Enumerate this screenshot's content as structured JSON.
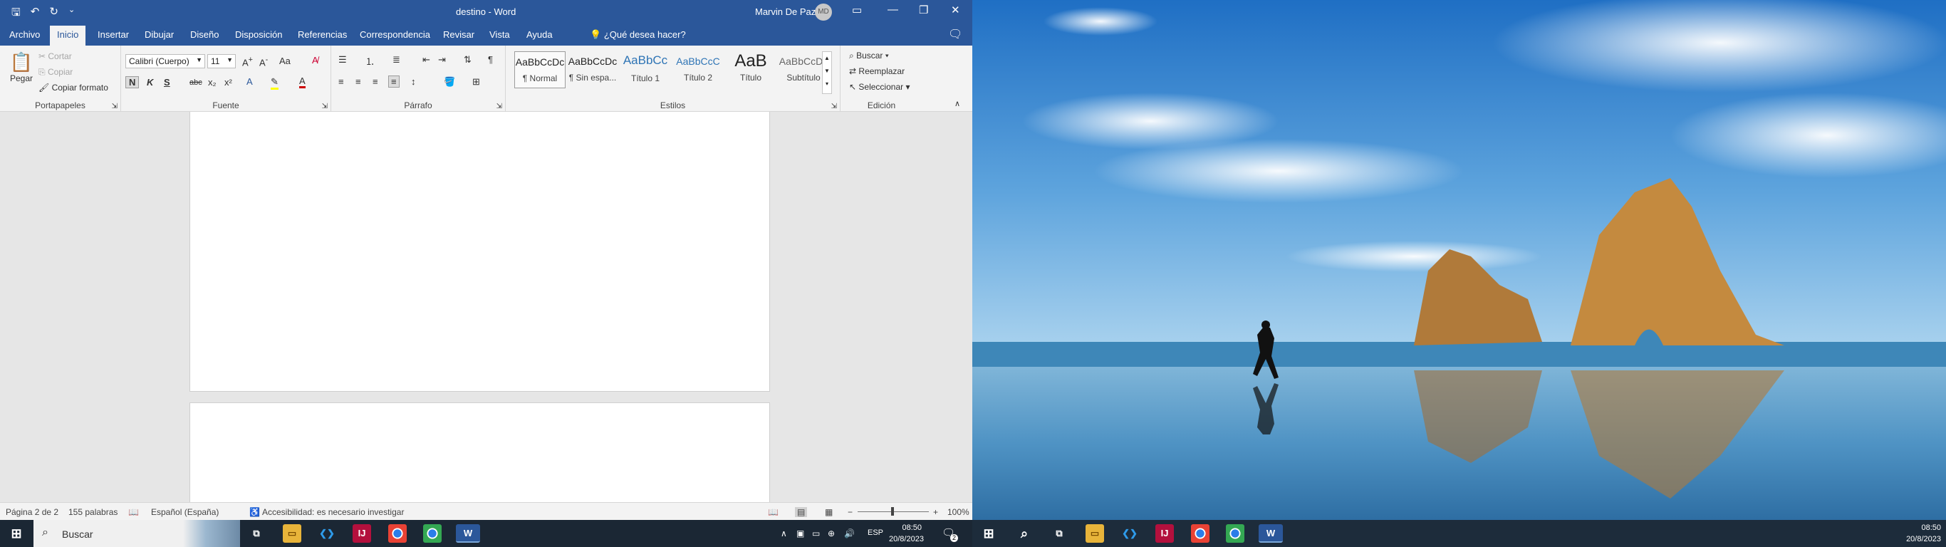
{
  "word": {
    "title": "destino  -  Word",
    "user_name": "Marvin De Paz",
    "user_initials": "MD",
    "tabs": [
      "Archivo",
      "Inicio",
      "Insertar",
      "Dibujar",
      "Diseño",
      "Disposición",
      "Referencias",
      "Correspondencia",
      "Revisar",
      "Vista",
      "Ayuda"
    ],
    "active_tab": "Inicio",
    "tell_me": "¿Qué desea hacer?",
    "clipboard": {
      "paste": "Pegar",
      "cut": "Cortar",
      "copy": "Copiar",
      "format_painter": "Copiar formato",
      "label": "Portapapeles"
    },
    "font": {
      "name": "Calibri (Cuerpo)",
      "size": "11",
      "label": "Fuente",
      "change_case": "Aa",
      "bold": "N",
      "italic": "K",
      "underline": "S",
      "strike": "abc",
      "sub": "x₂",
      "super": "x²"
    },
    "paragraph": {
      "label": "Párrafo"
    },
    "styles": {
      "label": "Estilos",
      "items": [
        {
          "sample": "AaBbCcDc",
          "name": "¶ Normal"
        },
        {
          "sample": "AaBbCcDc",
          "name": "¶ Sin espa..."
        },
        {
          "sample": "AaBbCc",
          "name": "Título 1"
        },
        {
          "sample": "AaBbCcC",
          "name": "Título 2"
        },
        {
          "sample": "AaB",
          "name": "Título"
        },
        {
          "sample": "AaBbCcDc",
          "name": "Subtítulo"
        }
      ]
    },
    "editing": {
      "label": "Edición",
      "find": "Buscar",
      "replace": "Reemplazar",
      "select": "Seleccionar"
    },
    "status": {
      "page": "Página 2 de 2",
      "words": "155 palabras",
      "language": "Español (España)",
      "accessibility": "Accesibilidad: es necesario investigar",
      "zoom": "100%"
    }
  },
  "taskbar": {
    "search_placeholder": "Buscar",
    "language": "ESP",
    "time": "08:50",
    "date": "20/8/2023",
    "notification_count": "2"
  },
  "colors": {
    "word_blue": "#2b579a",
    "taskbar": "#1b2734"
  }
}
